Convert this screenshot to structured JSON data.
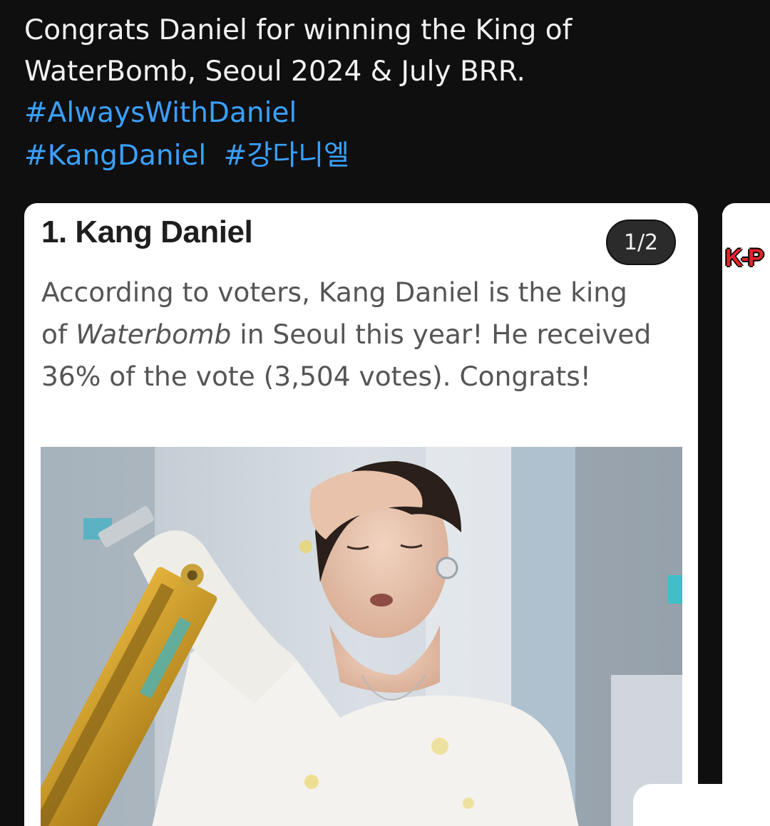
{
  "post": {
    "line1": "Congrats Daniel for winning the King of",
    "line2": "WaterBomb, Seoul 2024 & July BRR.",
    "hashtags_row1": [
      "#AlwaysWithDaniel"
    ],
    "hashtags_row2": [
      "#KangDaniel",
      "#강다니엘"
    ]
  },
  "carousel": {
    "counter": "1/2",
    "card": {
      "title": "1. Kang Daniel",
      "body_line1": "According to voters, Kang Daniel is the king",
      "body_line2_pre": "of ",
      "body_line2_em": "Waterbomb",
      "body_line2_post": " in Seoul this year! He received",
      "body_line3": "36% of the vote (3,504 votes). Congrats!",
      "image_alt": "Kang Daniel holding a yellow water gun at Waterbomb"
    },
    "next_card": {
      "logo_text": "K-P"
    }
  },
  "colors": {
    "background": "#0f0f10",
    "text": "#f2f2f2",
    "hashtag": "#3aa1ff",
    "card": "#ffffff",
    "counter_bg": "#2b2b2b"
  }
}
